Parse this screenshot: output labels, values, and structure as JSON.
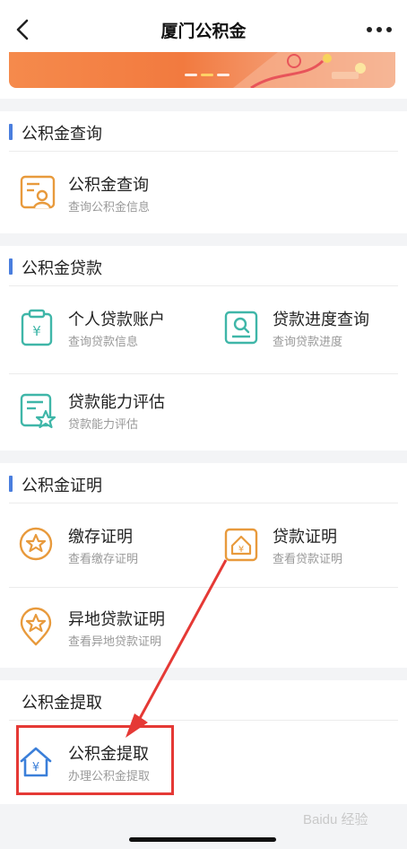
{
  "navbar": {
    "title": "厦门公积金"
  },
  "sections": [
    {
      "title": "公积金查询",
      "items": [
        {
          "title": "公积金查询",
          "subtitle": "查询公积金信息"
        }
      ]
    },
    {
      "title": "公积金贷款",
      "items": [
        {
          "title": "个人贷款账户",
          "subtitle": "查询贷款信息"
        },
        {
          "title": "贷款进度查询",
          "subtitle": "查询贷款进度"
        },
        {
          "title": "贷款能力评估",
          "subtitle": "贷款能力评估"
        }
      ]
    },
    {
      "title": "公积金证明",
      "items": [
        {
          "title": "缴存证明",
          "subtitle": "查看缴存证明"
        },
        {
          "title": "贷款证明",
          "subtitle": "查看贷款证明"
        },
        {
          "title": "异地贷款证明",
          "subtitle": "查看异地贷款证明"
        }
      ]
    },
    {
      "title": "公积金提取",
      "items": [
        {
          "title": "公积金提取",
          "subtitle": "办理公积金提取"
        }
      ]
    }
  ],
  "colors": {
    "accent_bar": "#4a7ede",
    "icon_orange": "#e89a3c",
    "icon_teal": "#3fb6a8",
    "icon_blue": "#3b7fd9",
    "annotation_red": "#e53935"
  },
  "watermark": "Baidu 经验"
}
